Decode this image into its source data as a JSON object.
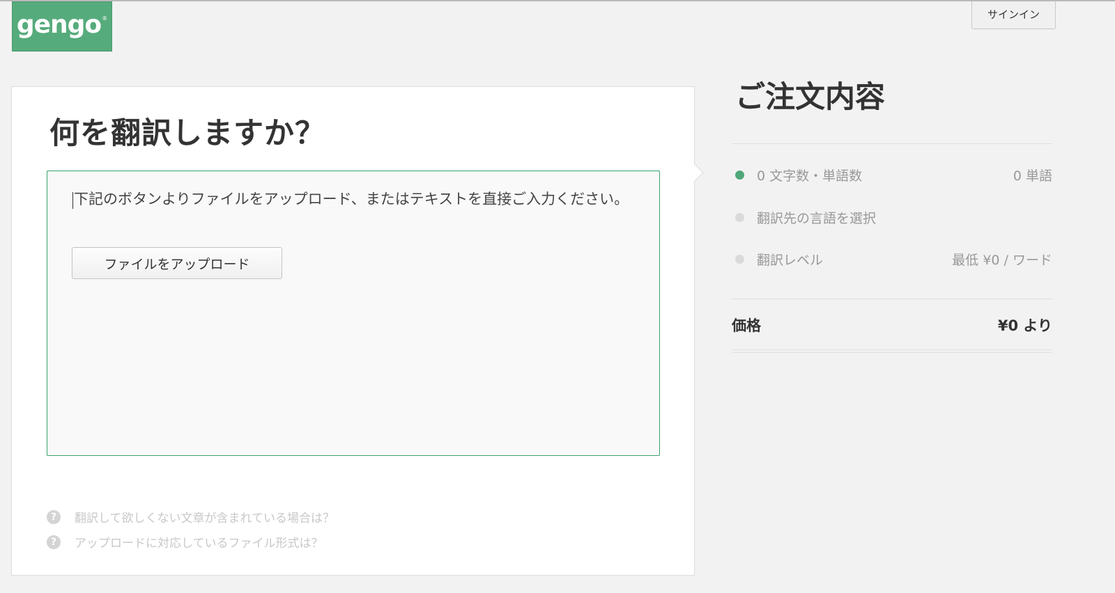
{
  "header": {
    "logo_text": "gengo",
    "logo_mark": "®",
    "signin_label": "サインイン"
  },
  "main": {
    "heading": "何を翻訳しますか？",
    "textarea_placeholder": "下記のボタンよりファイルをアップロード、またはテキストを直接ご入力ください。",
    "upload_button_label": "ファイルをアップロード",
    "help_links": [
      {
        "icon": "question-icon",
        "label": "翻訳して欲しくない文章が含まれている場合は？"
      },
      {
        "icon": "question-icon",
        "label": "アップロードに対応しているファイル形式は？"
      }
    ]
  },
  "summary": {
    "title": "ご注文内容",
    "rows": [
      {
        "label": "0 文字数・単語数",
        "value": "0 単語",
        "state": "active"
      },
      {
        "label": "翻訳先の言語を選択",
        "value": "",
        "state": "inactive"
      },
      {
        "label": "翻訳レベル",
        "value": "最低 ¥0 / ワード",
        "state": "inactive"
      }
    ],
    "price_label": "価格",
    "price_value": "¥0 より"
  },
  "colors": {
    "brand_green": "#56ab7c",
    "active_dot": "#4fa77a",
    "inactive_dot": "#dadada",
    "textarea_border": "#3aa06c"
  }
}
